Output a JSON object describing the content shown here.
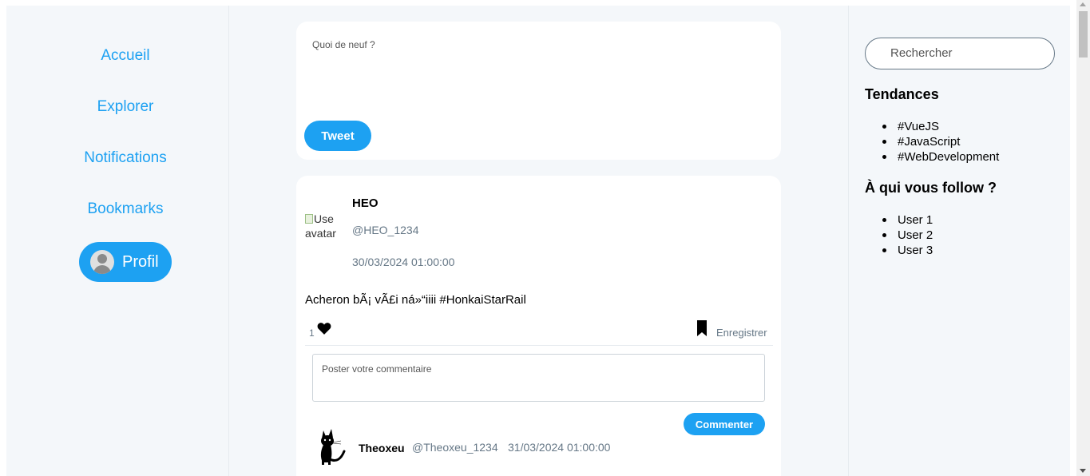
{
  "nav": {
    "items": [
      {
        "label": "Accueil"
      },
      {
        "label": "Explorer"
      },
      {
        "label": "Notifications"
      },
      {
        "label": "Bookmarks"
      }
    ],
    "profile_label": "Profil"
  },
  "composer": {
    "placeholder": "Quoi de neuf ?",
    "button_label": "Tweet"
  },
  "post": {
    "avatar_alt": "User avatar",
    "avatar_alt_line1": "Use",
    "avatar_alt_line2": "avatar",
    "author_name": "HEO",
    "author_handle": "@HEO_1234",
    "date": "30/03/2024 01:00:00",
    "text": "Acheron bÃ¡ vÃ£i ná»“iiii #HonkaiStarRail",
    "like_count": "1",
    "save_label": "Enregistrer",
    "comment_placeholder": "Poster votre commentaire",
    "comment_button_label": "Commenter",
    "comment": {
      "author_name": "Theoxeu",
      "author_handle": "@Theoxeu_1234",
      "date": "31/03/2024 01:00:00"
    }
  },
  "sidebar": {
    "search_placeholder": "Rechercher",
    "trends_title": "Tendances",
    "trends": [
      "#VueJS",
      "#JavaScript",
      "#WebDevelopment"
    ],
    "follow_title": "À qui vous follow ?",
    "follow": [
      "User 1",
      "User 2",
      "User 3"
    ]
  },
  "colors": {
    "accent": "#1da1f2",
    "page_bg": "#f4f7fa",
    "muted_text": "#657786"
  },
  "icons": [
    "heart-icon",
    "bookmark-icon",
    "user-silhouette-icon",
    "black-cat-avatar"
  ]
}
